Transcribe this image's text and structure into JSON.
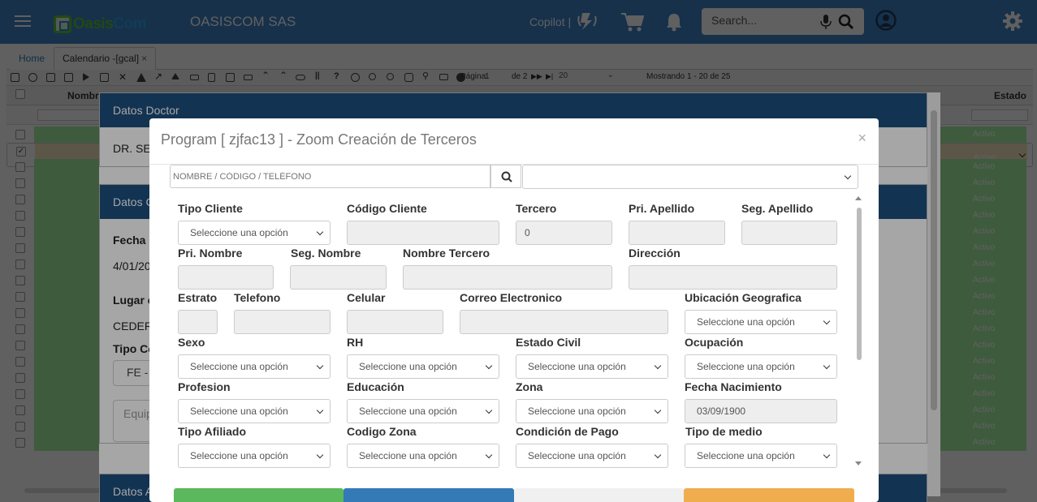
{
  "header": {
    "company": "OASISCOM SAS",
    "copilot_label": "Copilot |",
    "search_placeholder": "Search...",
    "logo_left": "Oasis",
    "logo_right": "Com"
  },
  "tabs": [
    {
      "label": "Home"
    },
    {
      "label": "Calendario -[gcal]",
      "close": "×"
    }
  ],
  "toolbar": {
    "page_label": "Página",
    "page_value": "1",
    "page_of": "de 2",
    "page_size": "20",
    "showing": "Mostrando 1 - 20 de 25"
  },
  "grid": {
    "col_name": "Nombr",
    "col_status": "Estado",
    "rows": [
      {
        "estado": "Activo",
        "selected": false
      },
      {
        "estado": "Activo",
        "selected": true
      },
      {
        "estado": "Activo",
        "selected": false
      },
      {
        "estado": "Activo",
        "selected": false
      },
      {
        "estado": "Activo",
        "selected": false
      },
      {
        "estado": "Activo",
        "selected": false
      },
      {
        "estado": "Activo",
        "selected": false
      },
      {
        "estado": "Activo",
        "selected": false
      },
      {
        "estado": "Activo",
        "selected": false
      },
      {
        "estado": "Activo",
        "selected": false
      },
      {
        "estado": "Activo",
        "selected": false
      },
      {
        "estado": "Activo",
        "selected": false
      },
      {
        "estado": "Activo",
        "selected": false
      },
      {
        "estado": "Activo",
        "selected": false
      },
      {
        "estado": "Activo",
        "selected": false
      },
      {
        "estado": "Activo",
        "selected": false
      },
      {
        "estado": "Activo",
        "selected": false
      },
      {
        "estado": "Activo",
        "selected": false
      },
      {
        "estado": "Activo",
        "selected": false
      },
      {
        "estado": "Activo",
        "selected": false
      }
    ]
  },
  "doctor_modal": {
    "section1_title": "Datos Doctor",
    "doctor_name": "DR. SE",
    "section2_title": "Datos C",
    "fecha_label": "Fecha",
    "fecha_value": "4/01/20",
    "lugar_label": "Lugar c",
    "lugar_value": "CEDER",
    "tipo_label": "Tipo Co",
    "tipo_value": "FE -",
    "equip_placeholder": "Equip",
    "section3_title": "Datos A"
  },
  "zoom_modal": {
    "title": "Program [ zjfac13 ] - Zoom Creación de Terceros",
    "close": "×",
    "search_placeholder": "NOMBRE / CÓDIGO / TELÉFONO",
    "fields": {
      "tipo_cliente": {
        "label": "Tipo Cliente",
        "value": "Seleccione una opción"
      },
      "codigo_cliente": {
        "label": "Código Cliente",
        "value": ""
      },
      "tercero": {
        "label": "Tercero",
        "value": "0"
      },
      "pri_apellido": {
        "label": "Pri. Apellido",
        "value": ""
      },
      "seg_apellido": {
        "label": "Seg. Apellido",
        "value": ""
      },
      "pri_nombre": {
        "label": "Pri. Nombre",
        "value": ""
      },
      "seg_nombre": {
        "label": "Seg. Nombre",
        "value": ""
      },
      "nombre_tercero": {
        "label": "Nombre Tercero",
        "value": ""
      },
      "direccion": {
        "label": "Dirección",
        "value": ""
      },
      "estrato": {
        "label": "Estrato",
        "value": ""
      },
      "telefono": {
        "label": "Telefono",
        "value": ""
      },
      "celular": {
        "label": "Celular",
        "value": ""
      },
      "correo": {
        "label": "Correo Electronico",
        "value": ""
      },
      "ubicacion": {
        "label": "Ubicación Geografica",
        "value": "Seleccione una opción"
      },
      "sexo": {
        "label": "Sexo",
        "value": "Seleccione una opción"
      },
      "rh": {
        "label": "RH",
        "value": "Seleccione una opción"
      },
      "estado_civil": {
        "label": "Estado Civil",
        "value": "Seleccione una opción"
      },
      "ocupacion": {
        "label": "Ocupación",
        "value": "Seleccione una opción"
      },
      "profesion": {
        "label": "Profesion",
        "value": "Seleccione una opción"
      },
      "educacion": {
        "label": "Educación",
        "value": "Seleccione una opción"
      },
      "zona": {
        "label": "Zona",
        "value": "Seleccione una opción"
      },
      "fecha_nacimiento": {
        "label": "Fecha Nacimiento",
        "value": "03/09/1900"
      },
      "tipo_afiliado": {
        "label": "Tipo Afiliado",
        "value": "Seleccione una opción"
      },
      "codigo_zona": {
        "label": "Codigo Zona",
        "value": "Seleccione una opción"
      },
      "condicion_pago": {
        "label": "Condición de Pago",
        "value": "Seleccione una opción"
      },
      "tipo_medio": {
        "label": "Tipo de medio",
        "value": "Seleccione una opción"
      }
    },
    "button_colors": [
      "#5cb85c",
      "#337ab7",
      "#f0f0f0",
      "#f0ad4e"
    ]
  },
  "colors": {
    "topbar": "#3e83c9",
    "panel_header": "#1e4f7f",
    "row_green": "#a9f1a5",
    "row_selected": "#f4e6c2"
  }
}
